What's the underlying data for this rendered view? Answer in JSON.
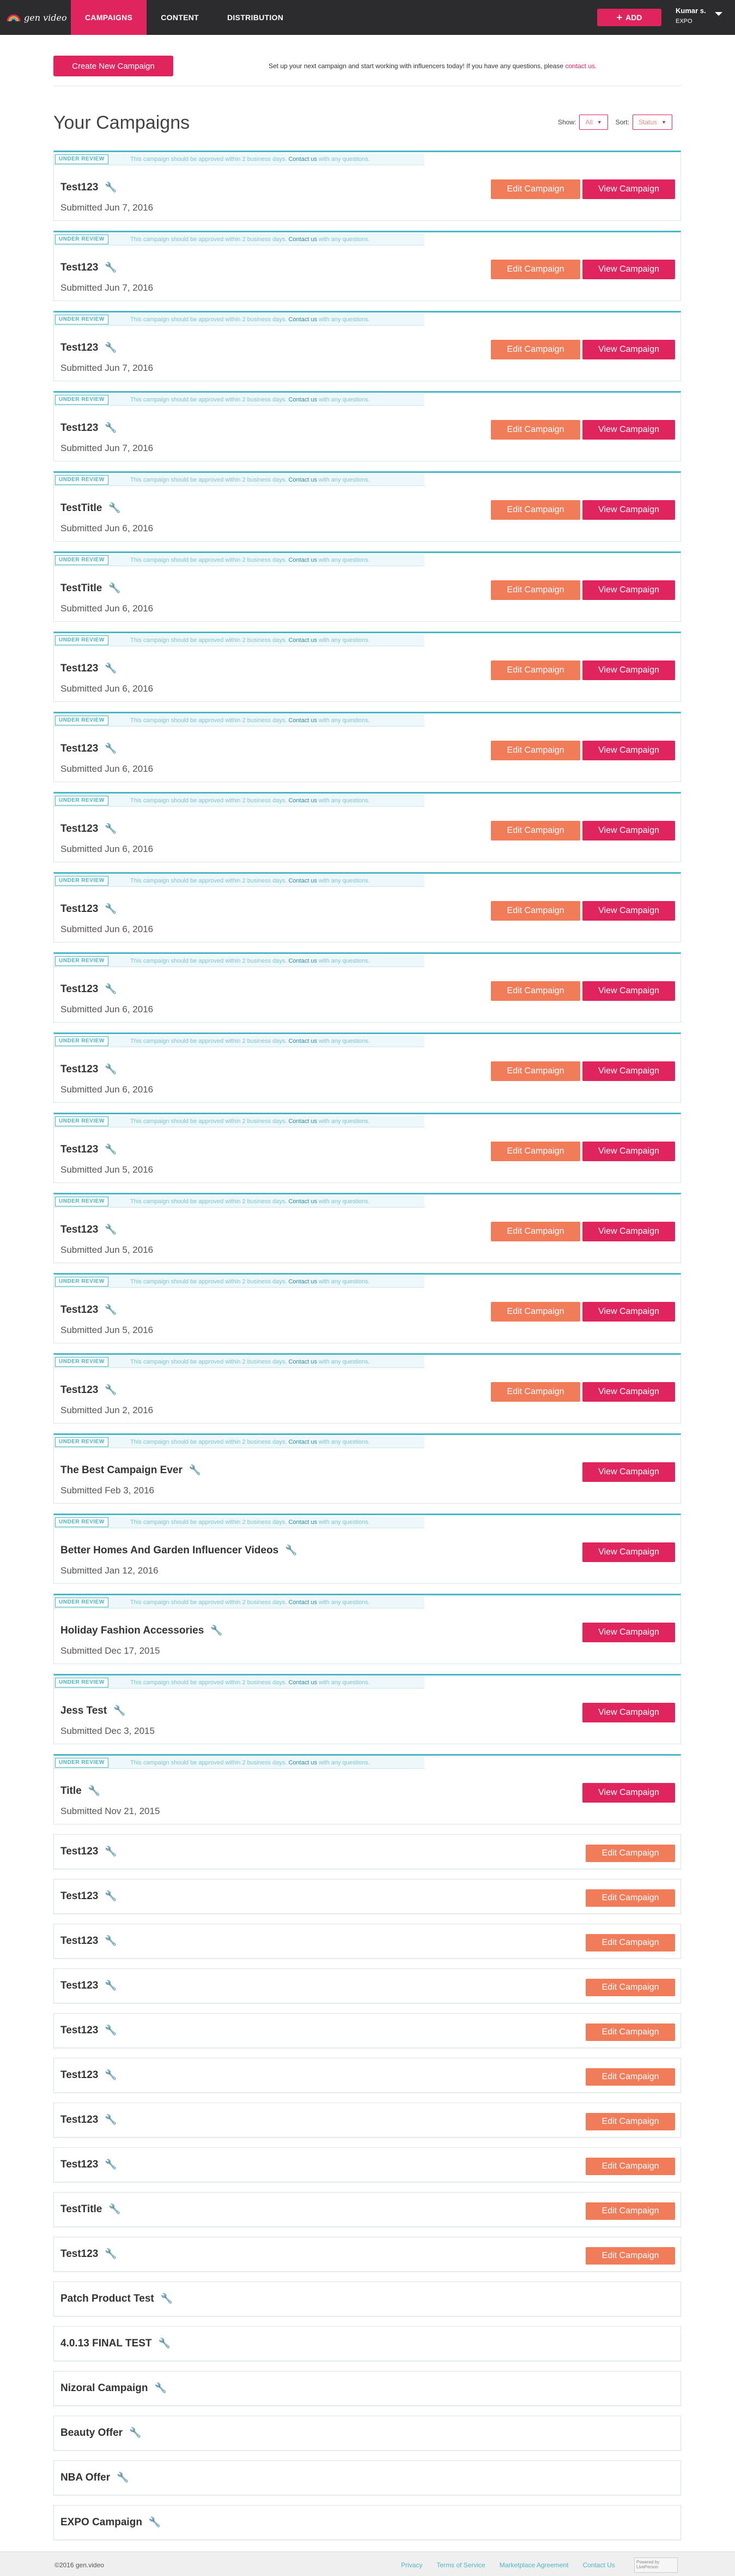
{
  "header": {
    "brand": "gen video",
    "nav": [
      "CAMPAIGNS",
      "CONTENT",
      "DISTRIBUTION"
    ],
    "add_label": "ADD",
    "user_name": "Kumar s.",
    "user_org": "EXPO"
  },
  "create": {
    "button_label": "Create New Campaign",
    "message": "Set up your next campaign and start working with influencers today! If you have any questions, please",
    "message_link": "contact us."
  },
  "title": "Your Campaigns",
  "filters": {
    "show_label": "Show:",
    "show_value": "All",
    "sort_label": "Sort:",
    "sort_value": "Status"
  },
  "review": {
    "badge": "UNDER REVIEW",
    "message_a": "This campaign should be approved within 2 business days.",
    "message_link": "Contact us",
    "message_b": "with any questions."
  },
  "labels": {
    "edit": "Edit Campaign",
    "view": "View Campaign"
  },
  "campaigns_reviewed": [
    {
      "name": "Test123",
      "date": "Submitted Jun 7, 2016",
      "edit": true
    },
    {
      "name": "Test123",
      "date": "Submitted Jun 7, 2016",
      "edit": true
    },
    {
      "name": "Test123",
      "date": "Submitted Jun 7, 2016",
      "edit": true
    },
    {
      "name": "Test123",
      "date": "Submitted Jun 7, 2016",
      "edit": true
    },
    {
      "name": "TestTitle",
      "date": "Submitted Jun 6, 2016",
      "edit": true
    },
    {
      "name": "TestTitle",
      "date": "Submitted Jun 6, 2016",
      "edit": true
    },
    {
      "name": "Test123",
      "date": "Submitted Jun 6, 2016",
      "edit": true
    },
    {
      "name": "Test123",
      "date": "Submitted Jun 6, 2016",
      "edit": true
    },
    {
      "name": "Test123",
      "date": "Submitted Jun 6, 2016",
      "edit": true
    },
    {
      "name": "Test123",
      "date": "Submitted Jun 6, 2016",
      "edit": true
    },
    {
      "name": "Test123",
      "date": "Submitted Jun 6, 2016",
      "edit": true
    },
    {
      "name": "Test123",
      "date": "Submitted Jun 6, 2016",
      "edit": true
    },
    {
      "name": "Test123",
      "date": "Submitted Jun 5, 2016",
      "edit": true
    },
    {
      "name": "Test123",
      "date": "Submitted Jun 5, 2016",
      "edit": true
    },
    {
      "name": "Test123",
      "date": "Submitted Jun 5, 2016",
      "edit": true
    },
    {
      "name": "Test123",
      "date": "Submitted Jun 2, 2016",
      "edit": true
    },
    {
      "name": "The Best Campaign Ever",
      "date": "Submitted Feb 3, 2016",
      "edit": false
    },
    {
      "name": "Better Homes And Garden Influencer Videos",
      "date": "Submitted Jan 12, 2016",
      "edit": false
    },
    {
      "name": "Holiday Fashion Accessories",
      "date": "Submitted Dec 17, 2015",
      "edit": false
    },
    {
      "name": "Jess Test",
      "date": "Submitted Dec 3, 2015",
      "edit": false
    },
    {
      "name": "Title",
      "date": "Submitted Nov 21, 2015",
      "edit": false
    }
  ],
  "campaigns_draft": [
    {
      "name": "Test123",
      "edit": true
    },
    {
      "name": "Test123",
      "edit": true
    },
    {
      "name": "Test123",
      "edit": true
    },
    {
      "name": "Test123",
      "edit": true
    },
    {
      "name": "Test123",
      "edit": true
    },
    {
      "name": "Test123",
      "edit": true
    },
    {
      "name": "Test123",
      "edit": true
    },
    {
      "name": "Test123",
      "edit": true
    },
    {
      "name": "TestTitle",
      "edit": true
    },
    {
      "name": "Test123",
      "edit": true
    },
    {
      "name": "Patch Product Test",
      "edit": false
    },
    {
      "name": "4.0.13 FINAL TEST",
      "edit": false
    },
    {
      "name": "Nizoral Campaign",
      "edit": false
    },
    {
      "name": "Beauty Offer",
      "edit": false
    },
    {
      "name": "NBA Offer",
      "edit": false
    },
    {
      "name": "EXPO Campaign",
      "edit": false
    }
  ],
  "footer": {
    "copyright": "©2016 gen.video",
    "links": [
      "Privacy",
      "Terms of Service",
      "Marketplace Agreement",
      "Contact Us"
    ],
    "chat_label": "Powered by LivePerson"
  },
  "colors": {
    "brand": "#e0245e",
    "edit": "#f07c5a",
    "review": "#4bb6c6",
    "topbar": "#2c2c2e"
  }
}
